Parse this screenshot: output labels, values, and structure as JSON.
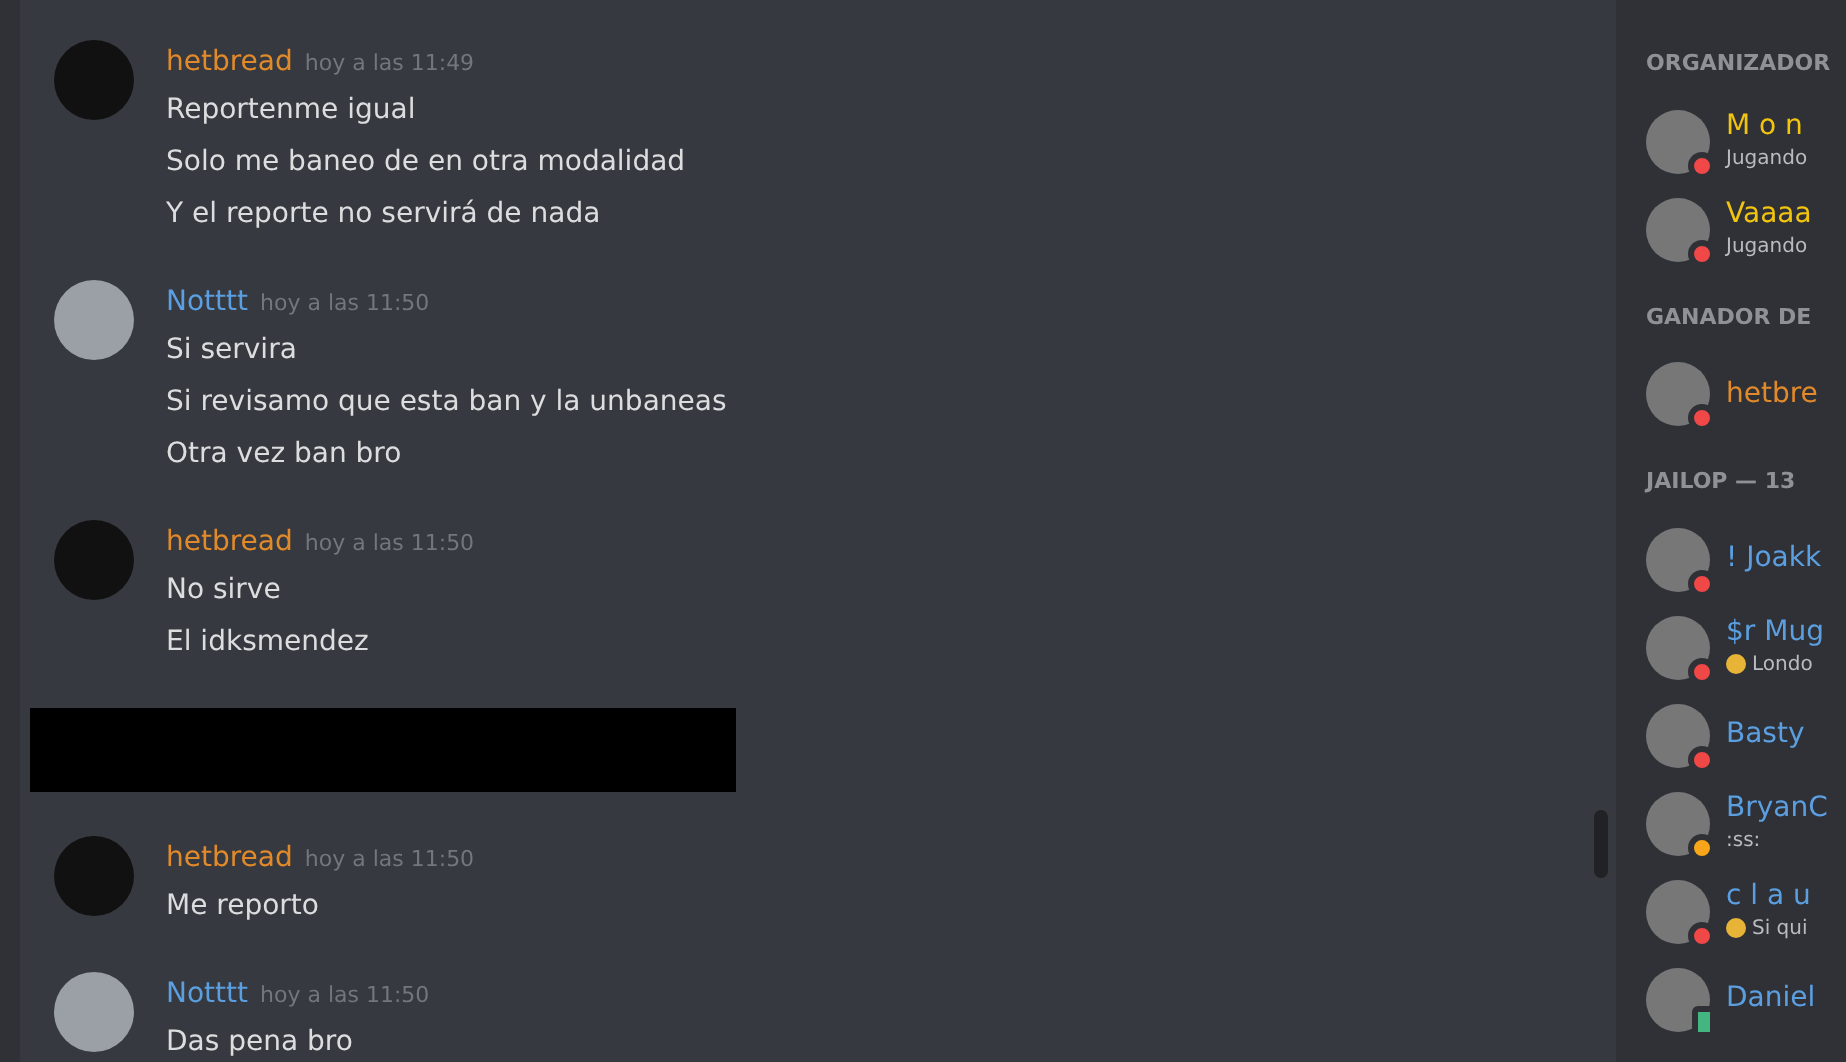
{
  "messages": [
    {
      "author": "hetbread",
      "color": "#e08a2b",
      "time": "hoy a las 11:49",
      "lines": [
        "Reportenme igual",
        "Solo me baneo de en otra modalidad",
        "Y el reporte no servirá de nada"
      ]
    },
    {
      "author": "Notttt",
      "color": "#5b9fe0",
      "time": "hoy a las 11:50",
      "lines": [
        "Si servira",
        "Si revisamo que esta ban y la unbaneas",
        "Otra vez ban bro"
      ]
    },
    {
      "author": "hetbread",
      "color": "#e08a2b",
      "time": "hoy a las 11:50",
      "lines": [
        "No sirve",
        "El idksmendez"
      ]
    },
    {
      "kind": "redacted"
    },
    {
      "author": "hetbread",
      "color": "#e08a2b",
      "time": "hoy a las 11:50",
      "lines": [
        "Me reporto"
      ]
    },
    {
      "author": "Notttt",
      "color": "#5b9fe0",
      "time": "hoy a las 11:50",
      "lines": [
        "Das pena bro"
      ]
    }
  ],
  "member_groups": [
    {
      "header": "ORGANIZADOR",
      "members": [
        {
          "name": "M o n",
          "color": "#f1c40f",
          "kind": "dnd",
          "activity": "Jugando"
        },
        {
          "name": "Vaaaa",
          "color": "#f1c40f",
          "kind": "dnd",
          "activity": "Jugando"
        }
      ]
    },
    {
      "header": "GANADOR DE",
      "members": [
        {
          "name": "hetbre",
          "color": "#e08a2b",
          "kind": "dnd"
        }
      ]
    },
    {
      "header": "JAILOP — 13",
      "members": [
        {
          "name": "! Joakk",
          "color": "#5b9fe0",
          "kind": "dnd"
        },
        {
          "name": "$r Mug",
          "color": "#5b9fe0",
          "kind": "dnd",
          "activity": "Londo",
          "emoji": true
        },
        {
          "name": "Basty",
          "color": "#5b9fe0",
          "kind": "dnd"
        },
        {
          "name": "BryanC",
          "color": "#5b9fe0",
          "kind": "idle",
          "activity": ":ss:"
        },
        {
          "name": "c l a u",
          "color": "#5b9fe0",
          "kind": "dnd",
          "activity": "Si qui",
          "emoji": true
        },
        {
          "name": "Daniel",
          "color": "#5b9fe0",
          "kind": "mobile"
        }
      ]
    }
  ]
}
